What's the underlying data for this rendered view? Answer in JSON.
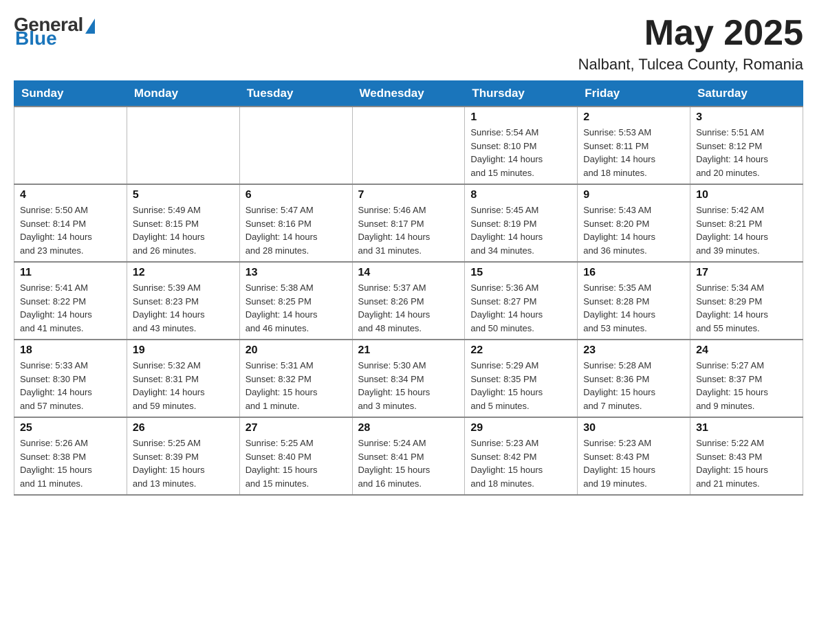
{
  "header": {
    "logo": {
      "general": "General",
      "blue": "Blue"
    },
    "month_year": "May 2025",
    "location": "Nalbant, Tulcea County, Romania"
  },
  "calendar": {
    "days_of_week": [
      "Sunday",
      "Monday",
      "Tuesday",
      "Wednesday",
      "Thursday",
      "Friday",
      "Saturday"
    ],
    "weeks": [
      [
        {
          "day": "",
          "info": ""
        },
        {
          "day": "",
          "info": ""
        },
        {
          "day": "",
          "info": ""
        },
        {
          "day": "",
          "info": ""
        },
        {
          "day": "1",
          "info": "Sunrise: 5:54 AM\nSunset: 8:10 PM\nDaylight: 14 hours\nand 15 minutes."
        },
        {
          "day": "2",
          "info": "Sunrise: 5:53 AM\nSunset: 8:11 PM\nDaylight: 14 hours\nand 18 minutes."
        },
        {
          "day": "3",
          "info": "Sunrise: 5:51 AM\nSunset: 8:12 PM\nDaylight: 14 hours\nand 20 minutes."
        }
      ],
      [
        {
          "day": "4",
          "info": "Sunrise: 5:50 AM\nSunset: 8:14 PM\nDaylight: 14 hours\nand 23 minutes."
        },
        {
          "day": "5",
          "info": "Sunrise: 5:49 AM\nSunset: 8:15 PM\nDaylight: 14 hours\nand 26 minutes."
        },
        {
          "day": "6",
          "info": "Sunrise: 5:47 AM\nSunset: 8:16 PM\nDaylight: 14 hours\nand 28 minutes."
        },
        {
          "day": "7",
          "info": "Sunrise: 5:46 AM\nSunset: 8:17 PM\nDaylight: 14 hours\nand 31 minutes."
        },
        {
          "day": "8",
          "info": "Sunrise: 5:45 AM\nSunset: 8:19 PM\nDaylight: 14 hours\nand 34 minutes."
        },
        {
          "day": "9",
          "info": "Sunrise: 5:43 AM\nSunset: 8:20 PM\nDaylight: 14 hours\nand 36 minutes."
        },
        {
          "day": "10",
          "info": "Sunrise: 5:42 AM\nSunset: 8:21 PM\nDaylight: 14 hours\nand 39 minutes."
        }
      ],
      [
        {
          "day": "11",
          "info": "Sunrise: 5:41 AM\nSunset: 8:22 PM\nDaylight: 14 hours\nand 41 minutes."
        },
        {
          "day": "12",
          "info": "Sunrise: 5:39 AM\nSunset: 8:23 PM\nDaylight: 14 hours\nand 43 minutes."
        },
        {
          "day": "13",
          "info": "Sunrise: 5:38 AM\nSunset: 8:25 PM\nDaylight: 14 hours\nand 46 minutes."
        },
        {
          "day": "14",
          "info": "Sunrise: 5:37 AM\nSunset: 8:26 PM\nDaylight: 14 hours\nand 48 minutes."
        },
        {
          "day": "15",
          "info": "Sunrise: 5:36 AM\nSunset: 8:27 PM\nDaylight: 14 hours\nand 50 minutes."
        },
        {
          "day": "16",
          "info": "Sunrise: 5:35 AM\nSunset: 8:28 PM\nDaylight: 14 hours\nand 53 minutes."
        },
        {
          "day": "17",
          "info": "Sunrise: 5:34 AM\nSunset: 8:29 PM\nDaylight: 14 hours\nand 55 minutes."
        }
      ],
      [
        {
          "day": "18",
          "info": "Sunrise: 5:33 AM\nSunset: 8:30 PM\nDaylight: 14 hours\nand 57 minutes."
        },
        {
          "day": "19",
          "info": "Sunrise: 5:32 AM\nSunset: 8:31 PM\nDaylight: 14 hours\nand 59 minutes."
        },
        {
          "day": "20",
          "info": "Sunrise: 5:31 AM\nSunset: 8:32 PM\nDaylight: 15 hours\nand 1 minute."
        },
        {
          "day": "21",
          "info": "Sunrise: 5:30 AM\nSunset: 8:34 PM\nDaylight: 15 hours\nand 3 minutes."
        },
        {
          "day": "22",
          "info": "Sunrise: 5:29 AM\nSunset: 8:35 PM\nDaylight: 15 hours\nand 5 minutes."
        },
        {
          "day": "23",
          "info": "Sunrise: 5:28 AM\nSunset: 8:36 PM\nDaylight: 15 hours\nand 7 minutes."
        },
        {
          "day": "24",
          "info": "Sunrise: 5:27 AM\nSunset: 8:37 PM\nDaylight: 15 hours\nand 9 minutes."
        }
      ],
      [
        {
          "day": "25",
          "info": "Sunrise: 5:26 AM\nSunset: 8:38 PM\nDaylight: 15 hours\nand 11 minutes."
        },
        {
          "day": "26",
          "info": "Sunrise: 5:25 AM\nSunset: 8:39 PM\nDaylight: 15 hours\nand 13 minutes."
        },
        {
          "day": "27",
          "info": "Sunrise: 5:25 AM\nSunset: 8:40 PM\nDaylight: 15 hours\nand 15 minutes."
        },
        {
          "day": "28",
          "info": "Sunrise: 5:24 AM\nSunset: 8:41 PM\nDaylight: 15 hours\nand 16 minutes."
        },
        {
          "day": "29",
          "info": "Sunrise: 5:23 AM\nSunset: 8:42 PM\nDaylight: 15 hours\nand 18 minutes."
        },
        {
          "day": "30",
          "info": "Sunrise: 5:23 AM\nSunset: 8:43 PM\nDaylight: 15 hours\nand 19 minutes."
        },
        {
          "day": "31",
          "info": "Sunrise: 5:22 AM\nSunset: 8:43 PM\nDaylight: 15 hours\nand 21 minutes."
        }
      ]
    ]
  }
}
